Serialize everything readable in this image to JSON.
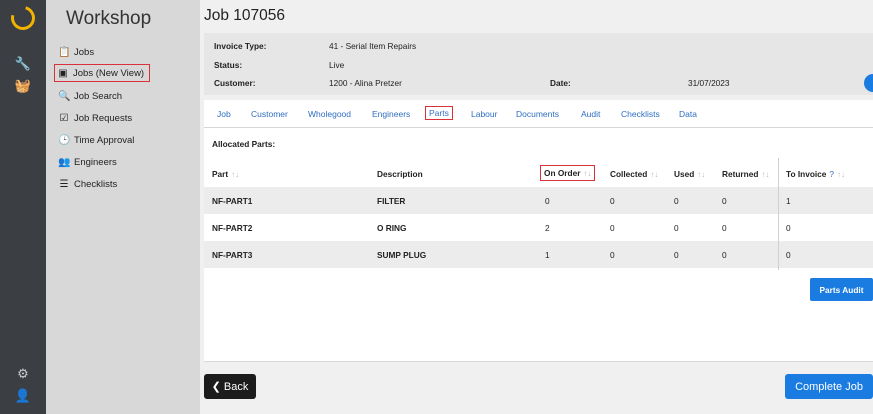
{
  "rail": {
    "icons": [
      "logo-icon",
      "wrench-icon",
      "basket-icon",
      "gear-icon",
      "user-icon"
    ]
  },
  "nav": {
    "title": "Workshop",
    "items": [
      {
        "label": "Jobs",
        "icon": "clipboard-icon"
      },
      {
        "label": "Jobs (New View)",
        "icon": "window-icon"
      },
      {
        "label": "Job Search",
        "icon": "search-icon"
      },
      {
        "label": "Job Requests",
        "icon": "clipboard-check-icon"
      },
      {
        "label": "Time Approval",
        "icon": "clock-icon"
      },
      {
        "label": "Engineers",
        "icon": "users-icon"
      },
      {
        "label": "Checklists",
        "icon": "list-icon"
      }
    ]
  },
  "job": {
    "title": "Job 107056",
    "invoice_type_label": "Invoice Type:",
    "invoice_type_value": "41 - Serial Item Repairs",
    "status_label": "Status:",
    "status_value": "Live",
    "customer_label": "Customer:",
    "customer_value": "1200 - Alina Pretzer",
    "date_label": "Date:",
    "date_value": "31/07/2023"
  },
  "tabs": [
    "Job",
    "Customer",
    "Wholegood",
    "Engineers",
    "Parts",
    "Labour",
    "Documents",
    "Audit",
    "Checklists",
    "Data"
  ],
  "active_tab": "Parts",
  "parts": {
    "section_title": "Allocated Parts:",
    "columns": [
      "Part",
      "Description",
      "On Order",
      "Collected",
      "Used",
      "Returned",
      "To Invoice"
    ],
    "sort_glyph": "↑↓",
    "info_glyph": "?",
    "rows": [
      [
        "NF-PART1",
        "FILTER",
        "0",
        "0",
        "0",
        "0",
        "1"
      ],
      [
        "NF-PART2",
        "O RING",
        "2",
        "0",
        "0",
        "0",
        "0"
      ],
      [
        "NF-PART3",
        "SUMP PLUG",
        "1",
        "0",
        "0",
        "0",
        "0"
      ]
    ],
    "audit_button": "Parts Audit"
  },
  "footer": {
    "back_label": "❮ Back",
    "complete_label": "Complete Job"
  },
  "colors": {
    "accent": "#1a7be0",
    "highlight": "#d9303a",
    "logo": "#f2b300"
  }
}
